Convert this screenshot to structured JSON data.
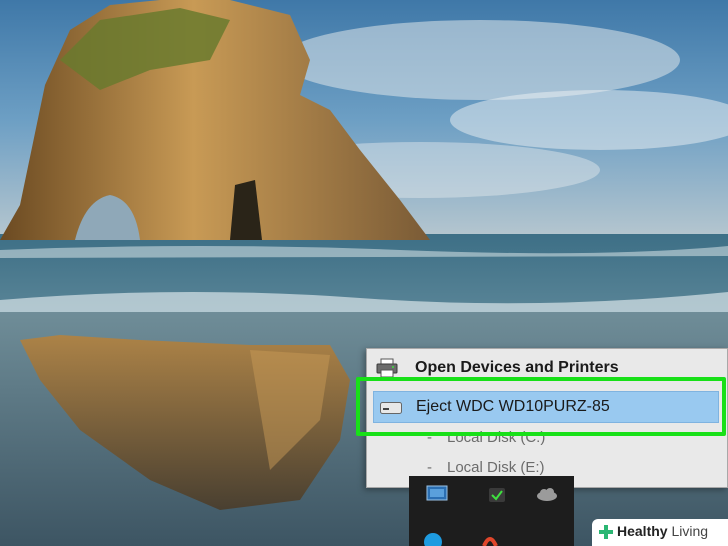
{
  "menu": {
    "open_devices": "Open Devices and Printers",
    "eject": "Eject WDC WD10PURZ-85",
    "sub_items": [
      {
        "dash": "-",
        "label": "Local Disk (C:)"
      },
      {
        "dash": "-",
        "label": "Local Disk (E:)"
      }
    ]
  },
  "watermark": {
    "brand": "Healthy",
    "brand2": "Living"
  },
  "icons": {
    "printer": "printer-icon",
    "drive": "usb-drive-icon",
    "brand": "health-cross-icon"
  },
  "colors": {
    "highlight": "#18e018",
    "selected_item": "#99c9f0",
    "menu_bg": "#e9e9e9",
    "watermark_accent": "#2bb673"
  }
}
